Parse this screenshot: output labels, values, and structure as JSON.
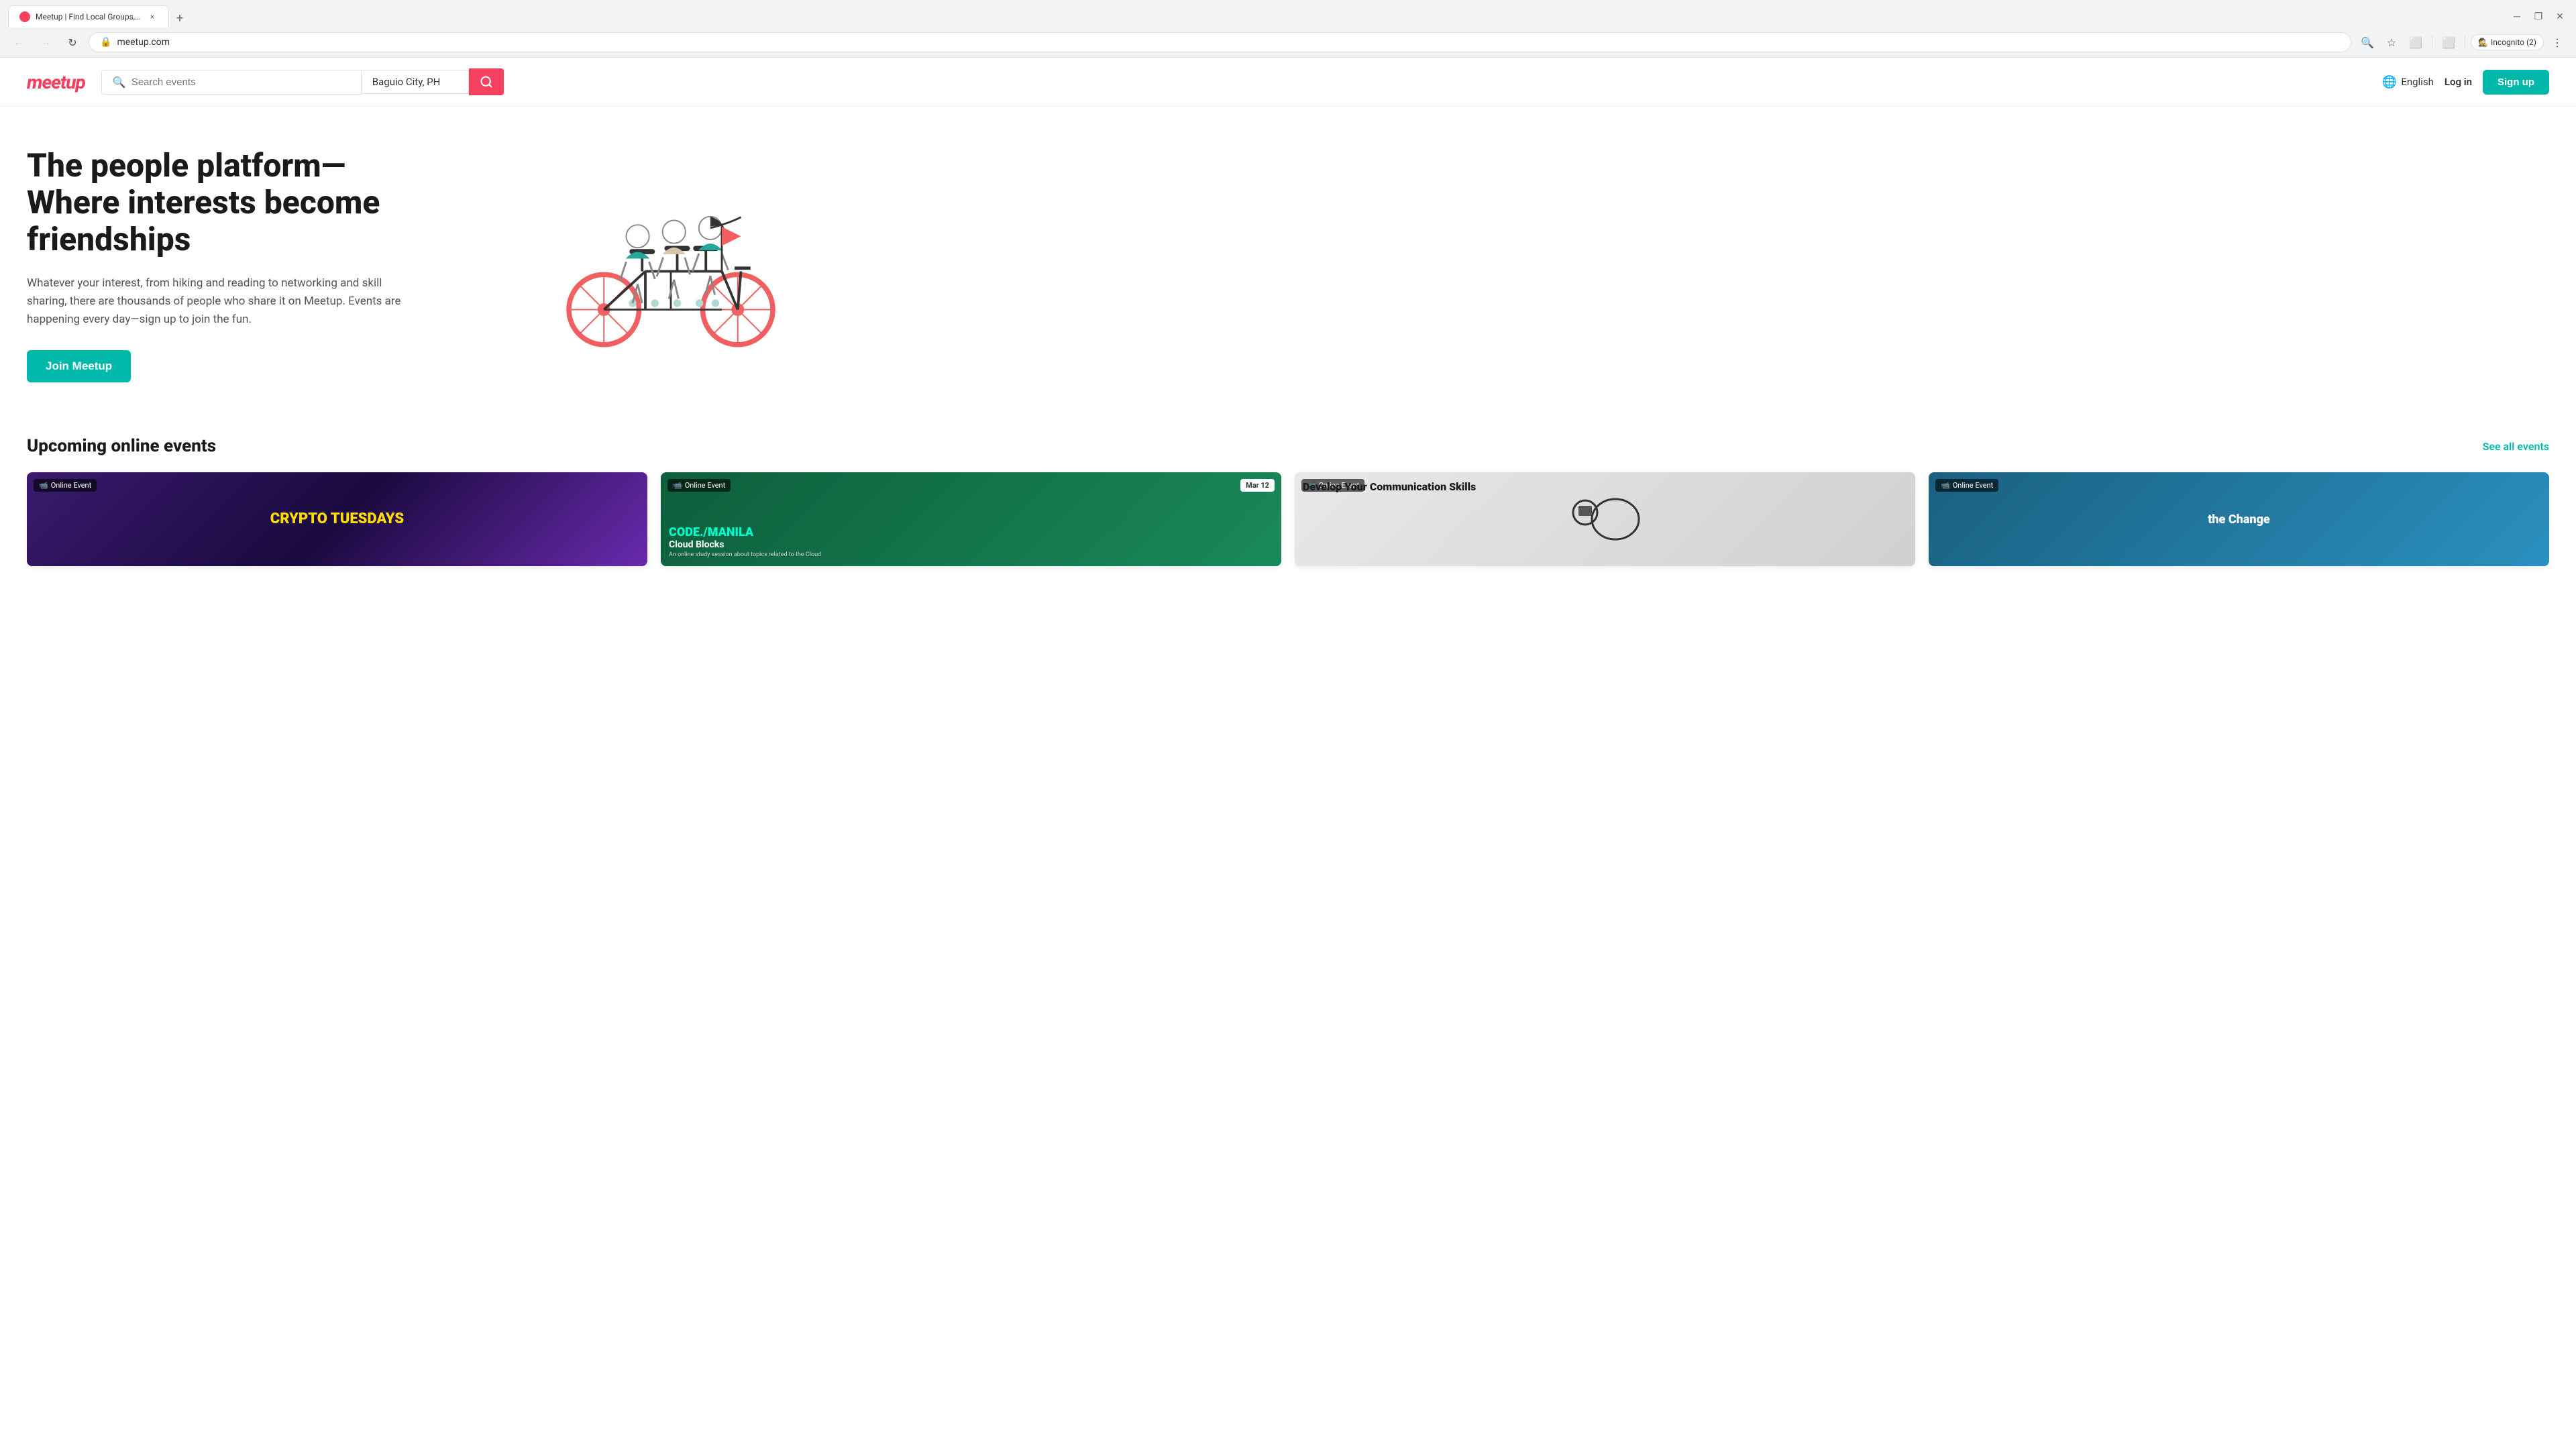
{
  "browser": {
    "tab": {
      "favicon_color": "#f64060",
      "title": "Meetup | Find Local Groups, Ev...",
      "close_label": "×"
    },
    "new_tab_label": "+",
    "window_controls": {
      "minimize": "─",
      "maximize": "❐",
      "close": "✕"
    },
    "toolbar": {
      "back_label": "←",
      "forward_label": "→",
      "refresh_label": "↻",
      "url": "meetup.com",
      "search_icon": "🔍",
      "bookmark_icon": "☆",
      "extensions_icon": "⬜",
      "split_icon": "⬜",
      "incognito_label": "Incognito (2)",
      "more_label": "⋮"
    }
  },
  "site": {
    "logo": "meetup",
    "header": {
      "search_placeholder": "Search events",
      "location_value": "Baguio City, PH",
      "search_button_icon": "🔍",
      "language_label": "English",
      "login_label": "Log in",
      "signup_label": "Sign up"
    },
    "hero": {
      "title": "The people platform—Where interests become friendships",
      "description": "Whatever your interest, from hiking and reading to networking and skill sharing, there are thousands of people who share it on Meetup. Events are happening every day—sign up to join the fun.",
      "cta_label": "Join Meetup"
    },
    "events_section": {
      "title": "Upcoming online events",
      "see_all_label": "See all events",
      "cards": [
        {
          "badge": "Online Event",
          "title": "CRYPTO TUESDAYS",
          "theme": "crypto"
        },
        {
          "badge": "Online Event",
          "date": "Mar 12",
          "group": "CODE./manila",
          "title": "Cloud Blocks",
          "description": "An online study session about topics related to the Cloud",
          "theme": "code"
        },
        {
          "badge": "Online Event",
          "title": "Develop Your Communication Skills",
          "theme": "communication"
        },
        {
          "badge": "Online Event",
          "title": "the Change",
          "theme": "change"
        }
      ]
    }
  }
}
